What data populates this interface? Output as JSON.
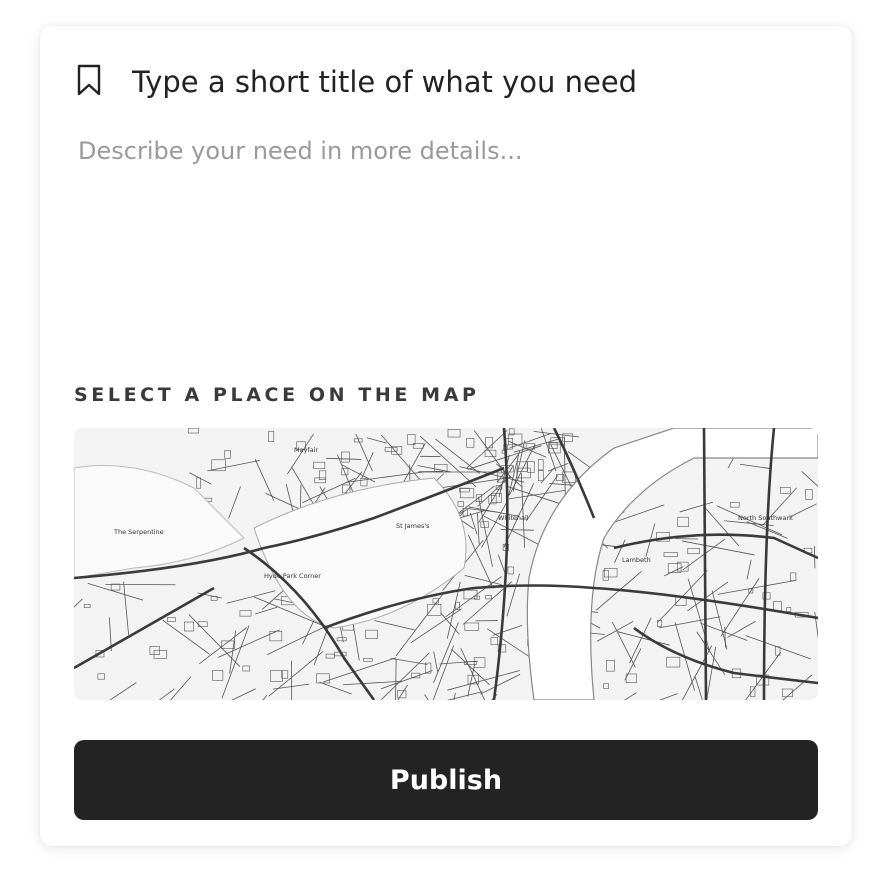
{
  "form": {
    "title_placeholder": "Type a short title of what you need",
    "description_placeholder": "Describe your need in more details...",
    "map_label": "SELECT A PLACE ON THE MAP",
    "publish_label": "Publish"
  },
  "map": {
    "place_labels": [
      "Mayfair",
      "St James's",
      "Hyde Park Corner",
      "Whitehall",
      "Lambeth",
      "North Southwark",
      "The Serpentine"
    ],
    "colors": {
      "background": "#f3f3f3",
      "park": "#fafafa",
      "water": "#ffffff",
      "street": "#555555",
      "major_road": "#3a3a3a"
    }
  },
  "icons": {
    "title_icon": "bookmark-icon"
  },
  "colors": {
    "button_bg": "#232323",
    "button_text": "#ffffff",
    "title_text": "#222222",
    "placeholder_text": "#9a9a9a",
    "label_text": "#3a3a3a"
  }
}
